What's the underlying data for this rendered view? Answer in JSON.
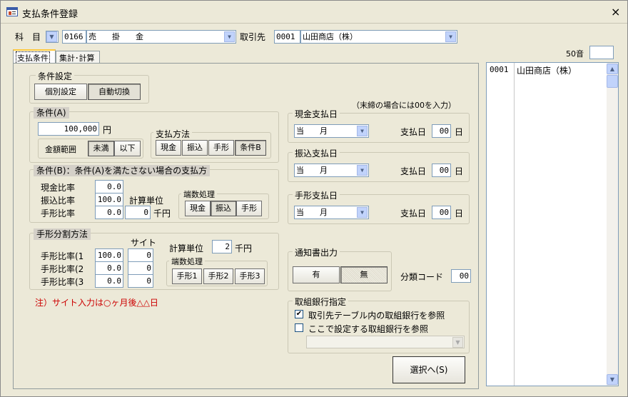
{
  "window": {
    "title": "支払条件登録",
    "close": "×"
  },
  "header": {
    "subject_label": "科　目",
    "subject_code": "0166",
    "subject_name": "売　　掛　　金",
    "vendor_label": "取引先",
    "vendor_code": "0001",
    "vendor_name": "山田商店（株）",
    "kana_label": "50音",
    "kana_value": ""
  },
  "tabs": [
    {
      "label": "支払条件"
    },
    {
      "label": "集計･計算"
    }
  ],
  "cond_setting": {
    "title": "条件設定",
    "btn_manual": "個別設定",
    "btn_auto": "自動切換"
  },
  "cond_a": {
    "title": "条件(A)",
    "amount": "100,000",
    "unit": "円",
    "range_label": "金額範囲",
    "btn_less": "未満",
    "btn_below": "以下",
    "pay_method_title": "支払方法",
    "btn_cash": "現金",
    "btn_transfer": "振込",
    "btn_bill": "手形",
    "btn_condb": "条件B"
  },
  "cond_b": {
    "title": "条件(B)：条件(A)を満たさない場合の支払方",
    "cash_label": "現金比率",
    "cash_value": "0.0",
    "transfer_label": "振込比率",
    "transfer_value": "100.0",
    "bill_label": "手形比率",
    "bill_value": "0.0",
    "calc_unit_label": "計算単位",
    "calc_unit_value": "0",
    "calc_unit_suffix": "千円",
    "rounding_title": "端数処理",
    "btn_cash": "現金",
    "btn_transfer": "振込",
    "btn_bill": "手形"
  },
  "bill_split": {
    "title": "手形分割方法",
    "site_label": "サイト",
    "rows": [
      {
        "label": "手形比率(1",
        "ratio": "100.0",
        "site": "0"
      },
      {
        "label": "手形比率(2",
        "ratio": "0.0",
        "site": "0"
      },
      {
        "label": "手形比率(3",
        "ratio": "0.0",
        "site": "0"
      }
    ],
    "calc_unit_label": "計算単位",
    "calc_unit_value": "2",
    "calc_unit_suffix": "千円",
    "rounding_title": "端数処理",
    "btn_bill1": "手形1",
    "btn_bill2": "手形2",
    "btn_bill3": "手形3"
  },
  "note": "注）サイト入力は○ヶ月後△△日",
  "cutoff_note": "（末締の場合には00を入力）",
  "cash_day": {
    "title": "現金支払日",
    "month": "当　　月",
    "day_label": "支払日",
    "day_value": "00",
    "day_suffix": "日"
  },
  "transfer_day": {
    "title": "振込支払日",
    "month": "当　　月",
    "day_label": "支払日",
    "day_value": "00",
    "day_suffix": "日"
  },
  "bill_day": {
    "title": "手形支払日",
    "month": "当　　月",
    "day_label": "支払日",
    "day_value": "00",
    "day_suffix": "日"
  },
  "notice": {
    "title": "通知書出力",
    "btn_yes": "有",
    "btn_no": "無"
  },
  "class_code": {
    "label": "分類コード",
    "value": "00"
  },
  "bank": {
    "title": "取組銀行指定",
    "opt1": "取引先テーブル内の取組銀行を参照",
    "opt1_checked": "✔",
    "opt2": "ここで設定する取組銀行を参照",
    "select_value": ""
  },
  "select_button": "選択へ(S)",
  "vendor_list": [
    {
      "code": "0001",
      "name": "山田商店（株）"
    }
  ],
  "colors": {
    "bg": "#ece9d8",
    "section_label": "#d4d0c8",
    "note": "#cc0000"
  }
}
